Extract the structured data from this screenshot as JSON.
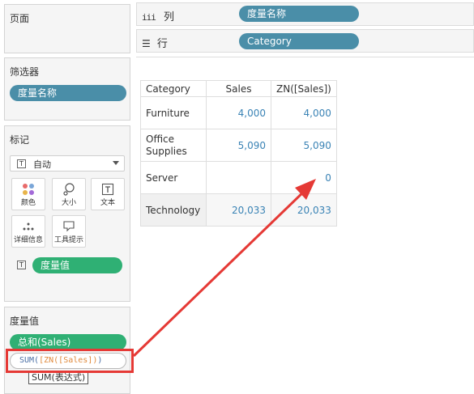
{
  "left": {
    "pages_title": "页面",
    "filters_title": "筛选器",
    "filter_pill": "度量名称",
    "marks_title": "标记",
    "marks_type": "自动",
    "marks_buttons": [
      "颜色",
      "大小",
      "文本",
      "详细信息",
      "工具提示"
    ],
    "marks_text_pill": "度量值",
    "measures_title": "度量值",
    "measure_pill_1": "总和(Sales)",
    "calc_prefix": "SUM(",
    "calc_expr": "[ZN([Sales])",
    "calc_suffix": ")",
    "tooltip": "SUM(表达式)"
  },
  "shelves": {
    "columns_label": "列",
    "columns_pill": "度量名称",
    "rows_label": "行",
    "rows_pill": "Category"
  },
  "table": {
    "headers": [
      "Category",
      "Sales",
      "ZN([Sales])"
    ],
    "rows": [
      {
        "category": "Furniture",
        "sales": "4,000",
        "zn": "4,000"
      },
      {
        "category": "Office Supplies",
        "sales": "5,090",
        "zn": "5,090"
      },
      {
        "category": "Server",
        "sales": "",
        "zn": "0"
      },
      {
        "category": "Technology",
        "sales": "20,033",
        "zn": "20,033"
      }
    ]
  },
  "colors": {
    "blue_pill": "#4a8ea8",
    "green_pill": "#2fb074",
    "value_text": "#3a83b5",
    "annotation_red": "#e53935"
  }
}
